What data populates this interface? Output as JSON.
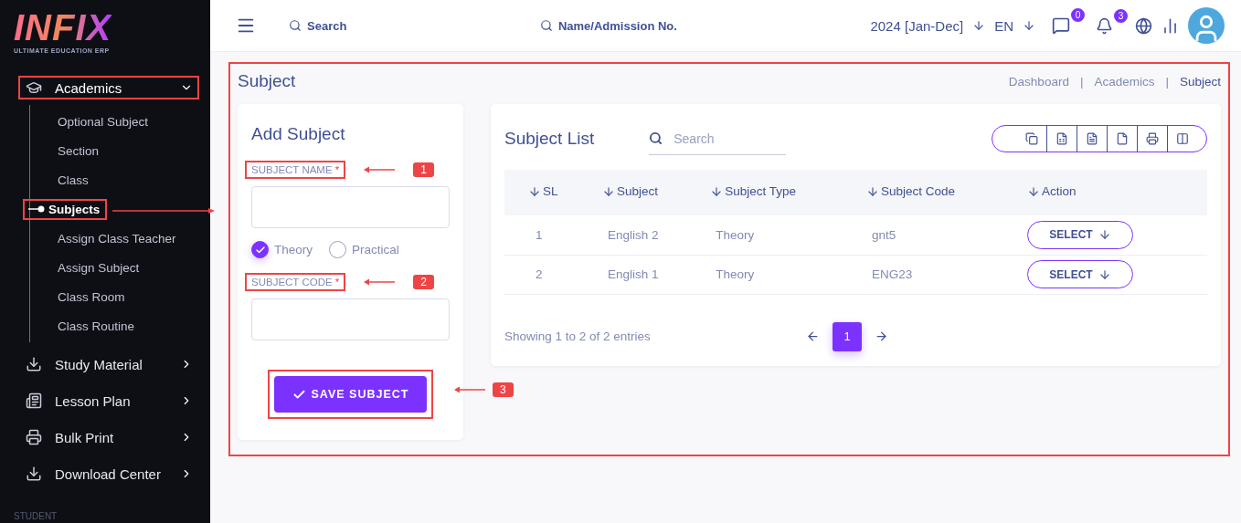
{
  "sidebar": {
    "logo": "INFIX",
    "tagline": "ULTIMATE EDUCATION ERP",
    "menu": [
      {
        "label": "Academics",
        "expanded": true,
        "annotated": true,
        "children": [
          {
            "label": "Optional Subject",
            "selected": false,
            "annotated": false
          },
          {
            "label": "Section",
            "selected": false,
            "annotated": false
          },
          {
            "label": "Class",
            "selected": false,
            "annotated": false
          },
          {
            "label": "Subjects",
            "selected": true,
            "annotated": true
          },
          {
            "label": "Assign Class Teacher",
            "selected": false,
            "annotated": false
          },
          {
            "label": "Assign Subject",
            "selected": false,
            "annotated": false
          },
          {
            "label": "Class Room",
            "selected": false,
            "annotated": false
          },
          {
            "label": "Class Routine",
            "selected": false,
            "annotated": false
          }
        ]
      },
      {
        "label": "Study Material",
        "expanded": false,
        "annotated": false
      },
      {
        "label": "Lesson Plan",
        "expanded": false,
        "annotated": false
      },
      {
        "label": "Bulk Print",
        "expanded": false,
        "annotated": false
      },
      {
        "label": "Download Center",
        "expanded": false,
        "annotated": false
      }
    ],
    "section": "STUDENT"
  },
  "topbar": {
    "search_placeholder": "Search",
    "admission_placeholder": "Name/Admission No.",
    "session": "2024 [Jan-Dec]",
    "language": "EN",
    "message_count": "0",
    "notification_count": "3"
  },
  "page": {
    "title": "Subject",
    "annotated": true,
    "breadcrumbs": [
      {
        "label": "Dashboard",
        "selected": false
      },
      {
        "label": "Academics",
        "selected": false
      },
      {
        "label": "Subject",
        "selected": true
      }
    ],
    "separator": "|"
  },
  "add_form": {
    "title": "Add Subject",
    "fields": [
      {
        "label": "SUBJECT NAME",
        "required_mark": "*",
        "annotated": true,
        "callout": "1"
      },
      {
        "label": "SUBJECT CODE",
        "required_mark": "*",
        "annotated": true,
        "callout": "2"
      }
    ],
    "subject_type": [
      {
        "label": "Theory",
        "selected": true
      },
      {
        "label": "Practical",
        "selected": false
      }
    ],
    "save_button": {
      "label": "SAVE SUBJECT",
      "annotated": true,
      "callout": "3"
    }
  },
  "list": {
    "title": "Subject List",
    "search_placeholder": "Search",
    "columns": [
      "SL",
      "Subject",
      "Subject Type",
      "Subject Code",
      "Action"
    ],
    "rows": [
      {
        "cells": [
          "1",
          "English 2",
          "Theory",
          "gnt5"
        ],
        "action": "SELECT"
      },
      {
        "cells": [
          "2",
          "English 1",
          "Theory",
          "ENG23"
        ],
        "action": "SELECT"
      }
    ],
    "info": "Showing 1 to 2 of 2 entries",
    "pages": [
      {
        "label": "1",
        "selected": true
      }
    ]
  }
}
